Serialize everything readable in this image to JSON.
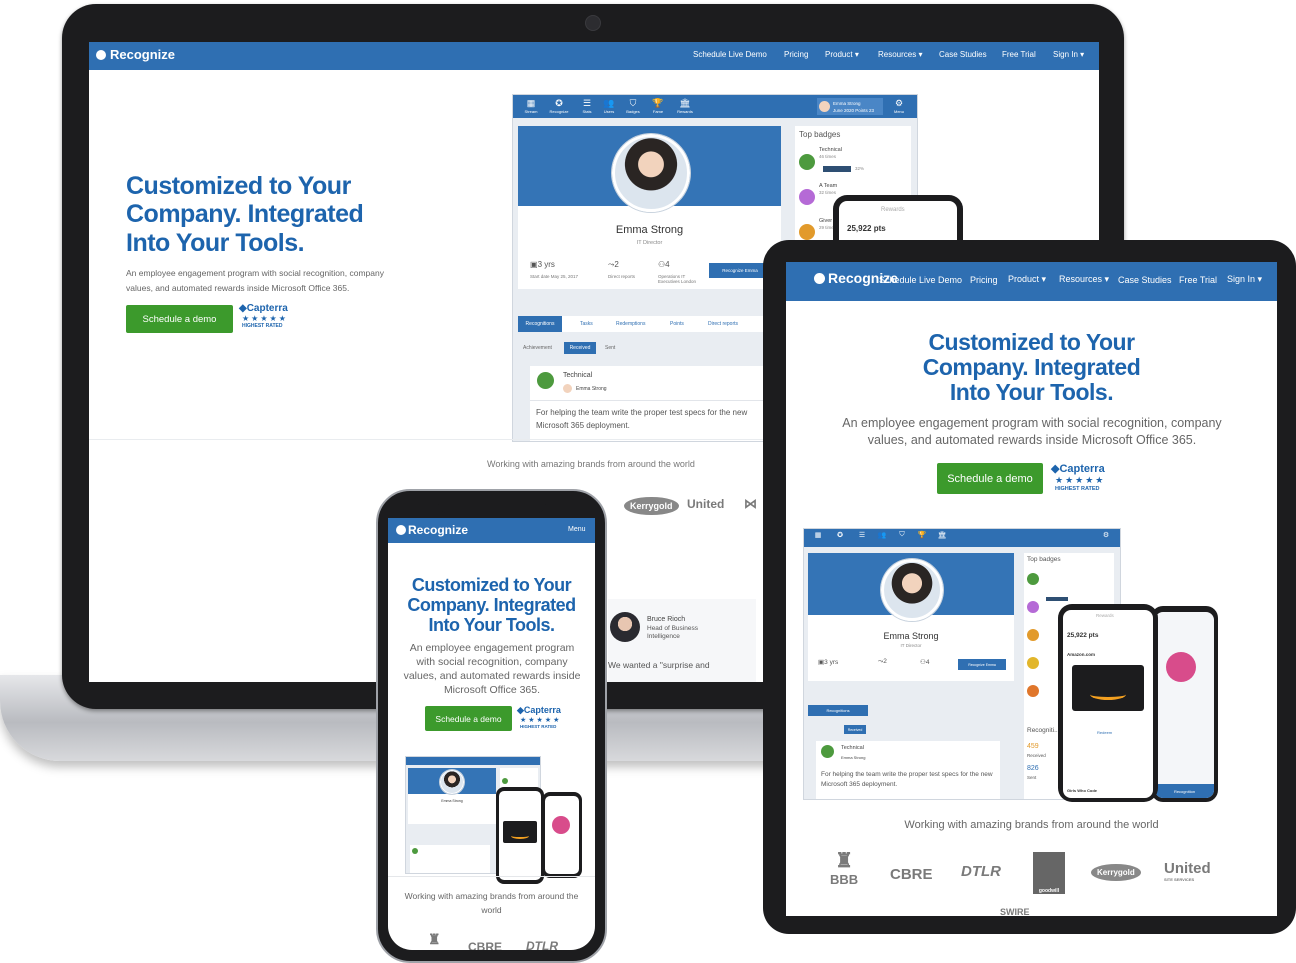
{
  "brand": {
    "name": "Recognize"
  },
  "nav": {
    "items": [
      "Schedule Live Demo",
      "Pricing",
      "Product",
      "Resources",
      "Case Studies",
      "Free Trial",
      "Sign In"
    ],
    "caret": "▾",
    "mobile_menu": "Menu"
  },
  "hero": {
    "title_line1": "Customized to Your",
    "title_line2": "Company. Integrated",
    "title_line3": "Into Your Tools.",
    "subtitle": "An employee engagement program with social recognition, company values, and automated rewards inside Microsoft Office 365.",
    "cta": "Schedule a demo"
  },
  "capterra": {
    "name": "Capterra",
    "stars": "★★★★★",
    "rated": "HIGHEST RATED"
  },
  "app": {
    "toolbar": [
      "Stream",
      "Recognize",
      "Stats",
      "Users",
      "Badges",
      "Fame",
      "Rewards"
    ],
    "user_name": "Emma Strong",
    "user_meta": "June 2020 Points 23",
    "menu_label": "Menu",
    "profile_name": "Emma Strong",
    "profile_role": "IT Director",
    "stat_years": "3 yrs",
    "stat_start": "Start date May 25, 2017",
    "stat_reports": "2",
    "stat_reports_label": "Direct reports",
    "stat_teams": "4",
    "stat_teams_label": "Operations IT Executives London",
    "recognize_button": "Recognize Emma",
    "tabs": [
      "Recognitions",
      "Tasks",
      "Redemptions",
      "Points",
      "Direct reports"
    ],
    "filters": [
      "Achievement",
      "Received",
      "Sent"
    ],
    "top_badges_title": "Top badges",
    "badges": [
      {
        "name": "Technical",
        "count": "46 times",
        "pct": "32%",
        "color": "#4d9a3e"
      },
      {
        "name": "A Team",
        "count": "32 times",
        "color": "#b56ad6"
      },
      {
        "name": "Giver",
        "count": "29 times",
        "color": "#e29a2b"
      }
    ],
    "recognition_badge": "Technical",
    "recognition_from": "Emma Strong",
    "recognition_text": "For helping the team write the proper test specs for the new Microsoft 365 deployment.",
    "recognitions_label": "Recogniti...",
    "received_count": "459",
    "received_label": "Received",
    "sent_count": "826",
    "sent_label": "Sent",
    "phone_points": "25,922 pts",
    "phone_rewards": "Rewards",
    "phone_recognition": "Recognition",
    "phone_amazon": "Amazon.com",
    "phone_redeem": "Redeem",
    "phone_gift": "Girls Who Code"
  },
  "brands_heading": "Working with amazing brands from around the world",
  "brands": [
    "BBB",
    "CBRE",
    "DTLR",
    "goodwill",
    "Kerrygold",
    "United",
    "SWIRE"
  ],
  "brands_sub": {
    "united": "SITE SERVICES"
  },
  "testimonial": {
    "name": "Bruce Rioch",
    "title_line1": "Head of Business",
    "title_line2": "Intelligence",
    "quote": "We wanted a \"surprise and"
  }
}
